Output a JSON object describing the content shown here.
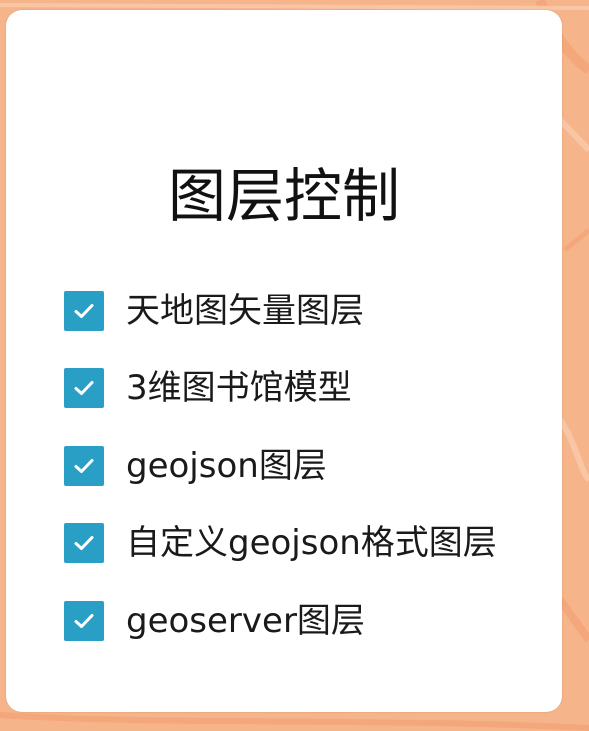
{
  "panel": {
    "title": "图层控制"
  },
  "layers": [
    {
      "label": "天地图矢量图层",
      "checked": true
    },
    {
      "label": "3维图书馆模型",
      "checked": true
    },
    {
      "label": "geojson图层",
      "checked": true
    },
    {
      "label": "自定义geojson格式图层",
      "checked": true
    },
    {
      "label": "geoserver图层",
      "checked": true
    }
  ],
  "colors": {
    "map_background": "#f6b48a",
    "checkbox_fill": "#2a9fc6",
    "panel_background": "#ffffff",
    "text": "#1a1a1a"
  },
  "icons": {
    "checkbox": "check-icon"
  }
}
